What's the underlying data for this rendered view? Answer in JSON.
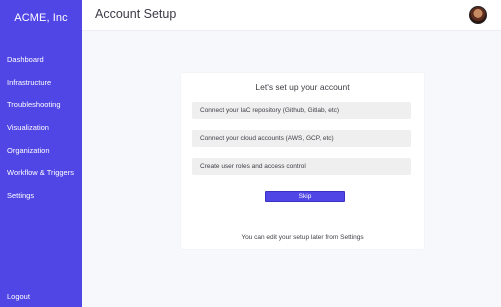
{
  "sidebar": {
    "brand": "ACME, Inc",
    "items": [
      {
        "label": "Dashboard"
      },
      {
        "label": "Infrastructure"
      },
      {
        "label": "Troubleshooting"
      },
      {
        "label": "Visualization"
      },
      {
        "label": "Organization"
      },
      {
        "label": "Workflow & Triggers"
      },
      {
        "label": "Settings"
      }
    ],
    "logout": "Logout"
  },
  "header": {
    "title": "Account Setup"
  },
  "setup_card": {
    "title": "Let's set up your account",
    "steps": [
      {
        "label": "Connect your IaC repository (Github, Gitlab, etc)"
      },
      {
        "label": "Connect your cloud accounts (AWS, GCP, etc)"
      },
      {
        "label": "Create user roles and access control"
      }
    ],
    "skip_label": "Skip",
    "footnote": "You can edit your setup later from Settings"
  },
  "colors": {
    "accent": "#5045e5",
    "background": "#f7f8fc"
  }
}
